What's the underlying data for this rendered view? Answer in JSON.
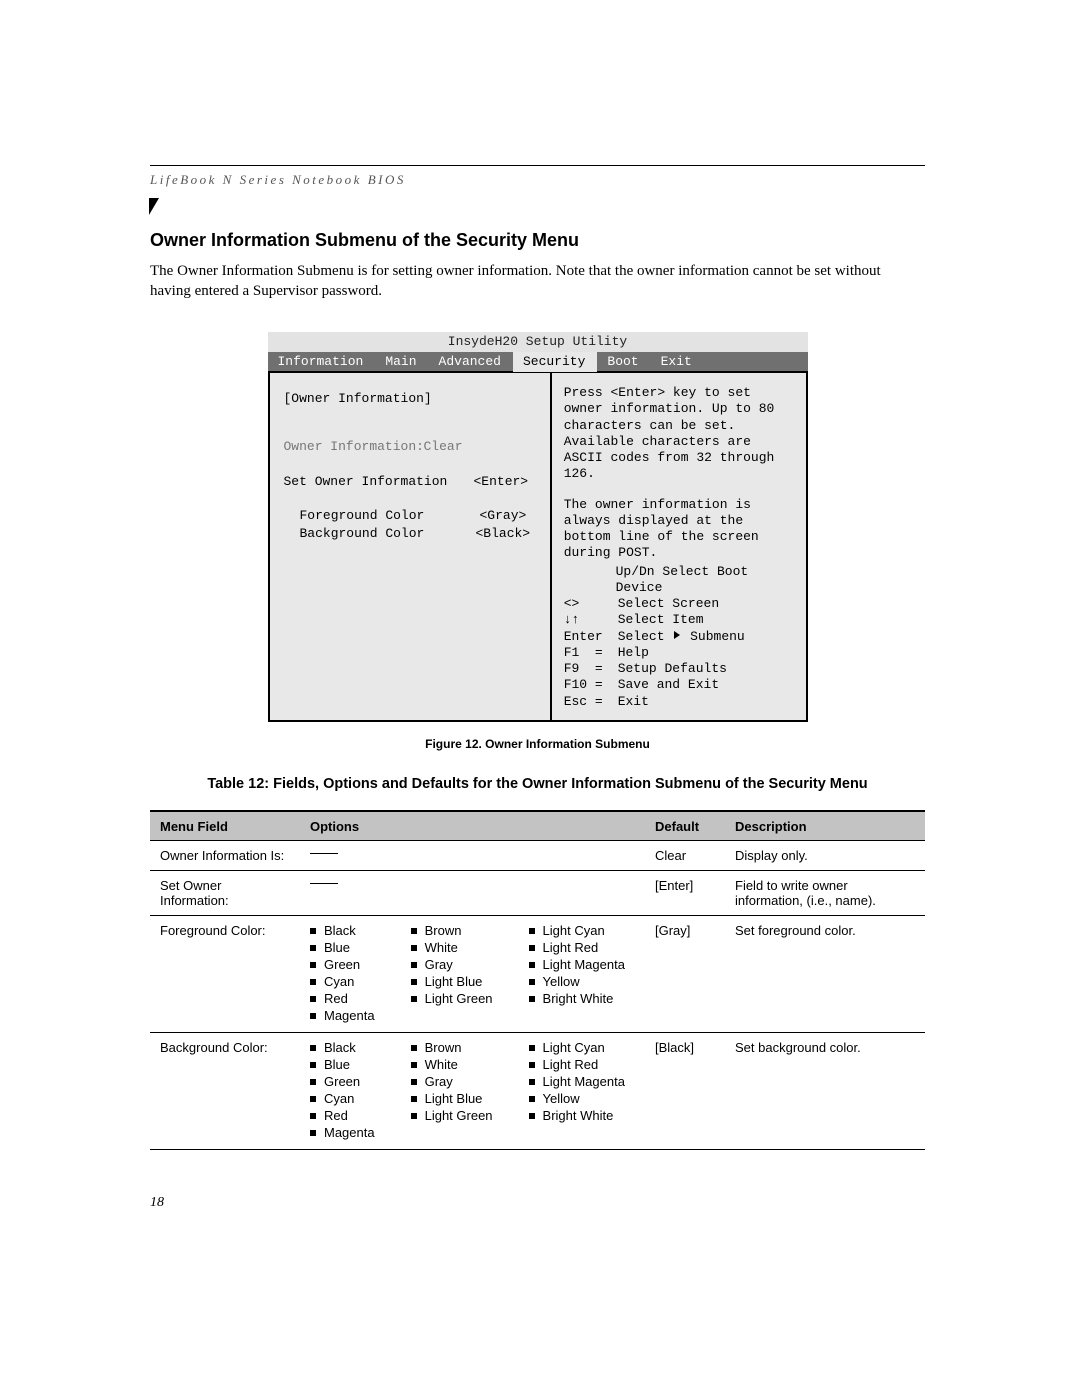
{
  "page_header": "LifeBook N Series Notebook BIOS",
  "section_title": "Owner Information Submenu of the Security Menu",
  "section_desc": "The Owner Information Submenu is for setting owner information. Note that the owner information cannot be set without having entered a Supervisor password.",
  "bios": {
    "title": "InsydeH20 Setup Utility",
    "tabs": [
      "Information",
      "Main",
      "Advanced",
      "Security",
      "Boot",
      "Exit"
    ],
    "active_tab": "Security",
    "left": {
      "group_header": "[Owner Information]",
      "owner_info_label": "Owner Information:",
      "owner_info_value": "Clear",
      "set_owner_label": "Set Owner Information",
      "set_owner_value": "<Enter>",
      "fg_label": "Foreground Color",
      "fg_value": "<Gray>",
      "bg_label": "Background Color",
      "bg_value": "<Black>"
    },
    "help": {
      "p1": "Press <Enter> key to set owner information. Up to 80 characters can be set. Available characters are ASCII codes from 32 through 126.",
      "p2": "The owner information is always displayed at the bottom line of the screen during POST.",
      "keys": [
        [
          "",
          "Up/Dn Select Boot Device"
        ],
        [
          "<>",
          "Select Screen"
        ],
        [
          "↓↑",
          "Select Item"
        ],
        [
          "Enter",
          "Select   Submenu"
        ],
        [
          "F1  =",
          "Help"
        ],
        [
          "F9  =",
          "Setup Defaults"
        ],
        [
          "F10 =",
          "Save and Exit"
        ],
        [
          "Esc =",
          "Exit"
        ]
      ]
    }
  },
  "figure_caption": "Figure 12.   Owner Information Submenu",
  "table_caption": "Table 12: Fields, Options and Defaults for the Owner Information Submenu of the Security Menu",
  "table": {
    "headers": [
      "Menu Field",
      "Options",
      "Default",
      "Description"
    ],
    "rows": [
      {
        "menu": "Owner Information Is:",
        "options_text": "—",
        "default": "Clear",
        "desc": "Display only."
      },
      {
        "menu": "Set Owner Information:",
        "options_text": "—",
        "default": "[Enter]",
        "desc": "Field to write owner information, (i.e., name)."
      },
      {
        "menu": "Foreground Color:",
        "options": [
          [
            "Black",
            "Blue",
            "Green",
            "Cyan",
            "Red",
            "Magenta"
          ],
          [
            "Brown",
            "White",
            "Gray",
            "Light Blue",
            "Light Green"
          ],
          [
            "Light Cyan",
            "Light Red",
            "Light Magenta",
            "Yellow",
            "Bright White"
          ]
        ],
        "default": "[Gray]",
        "desc": "Set foreground color."
      },
      {
        "menu": "Background Color:",
        "options": [
          [
            "Black",
            "Blue",
            "Green",
            "Cyan",
            "Red",
            "Magenta"
          ],
          [
            "Brown",
            "White",
            "Gray",
            "Light Blue",
            "Light Green"
          ],
          [
            "Light Cyan",
            "Light Red",
            "Light Magenta",
            "Yellow",
            "Bright White"
          ]
        ],
        "default": "[Black]",
        "desc": "Set background color."
      }
    ]
  },
  "page_number": "18"
}
